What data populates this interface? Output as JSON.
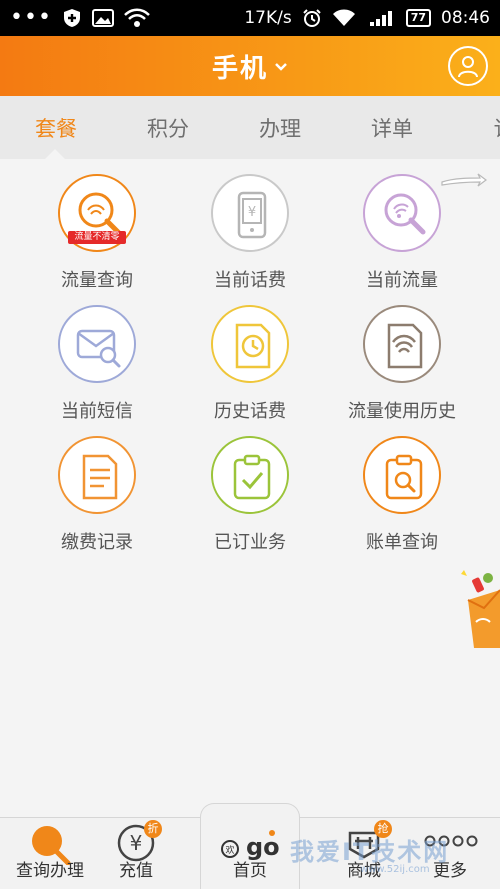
{
  "status_bar": {
    "speed": "17K/s",
    "battery": "77",
    "time": "08:46"
  },
  "header": {
    "title": "手机",
    "title_dropdown_icon": "chevron-down-icon",
    "user_icon": "user-icon"
  },
  "tabs": [
    {
      "label": "套餐",
      "active": true
    },
    {
      "label": "积分",
      "active": false
    },
    {
      "label": "办理",
      "active": false
    },
    {
      "label": "详单",
      "active": false
    },
    {
      "label": "订",
      "active": false
    }
  ],
  "grid": [
    {
      "label": "流量查询",
      "icon": "data-search-icon",
      "tag": "流量不清零",
      "color": "#f08719"
    },
    {
      "label": "当前话费",
      "icon": "phone-bill-icon",
      "color": "#c9c9c9"
    },
    {
      "label": "当前流量",
      "icon": "data-usage-icon",
      "color": "#c7a3d6"
    },
    {
      "label": "当前短信",
      "icon": "sms-search-icon",
      "color": "#9ea9d8"
    },
    {
      "label": "历史话费",
      "icon": "bill-history-icon",
      "color": "#efc63a"
    },
    {
      "label": "流量使用历史",
      "icon": "data-history-icon",
      "color": "#9a8a7c"
    },
    {
      "label": "缴费记录",
      "icon": "payment-record-icon",
      "color": "#f19433"
    },
    {
      "label": "已订业务",
      "icon": "subscribed-icon",
      "color": "#9bc43a"
    },
    {
      "label": "账单查询",
      "icon": "bill-search-icon",
      "color": "#f08719"
    }
  ],
  "bottom_nav": [
    {
      "label": "查询办理",
      "icon": "search-icon",
      "active": true
    },
    {
      "label": "充值",
      "icon": "yuan-icon",
      "badge": "折"
    },
    {
      "label": "首页",
      "icon": "home-logo-icon",
      "logo": "go"
    },
    {
      "label": "商城",
      "icon": "shop-icon",
      "badge": "抢"
    },
    {
      "label": "更多",
      "icon": "more-icon"
    }
  ],
  "watermark": {
    "text": "我爱IT技术网",
    "sub": "www.52ij.com"
  }
}
